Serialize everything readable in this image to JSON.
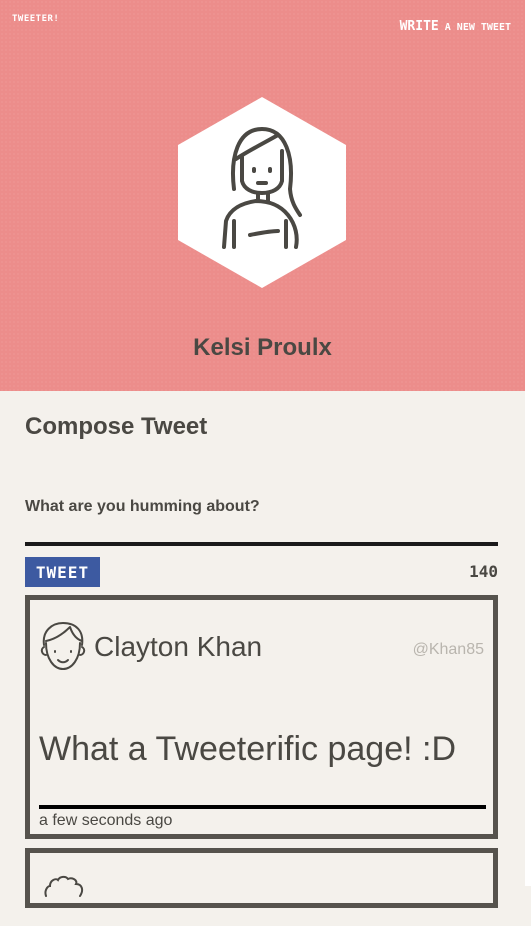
{
  "header": {
    "brand": "TWEETER!",
    "write_link_big": "WRITE",
    "write_link_small": " A NEW TWEET",
    "background_color": "#ec8d8b",
    "profile_name": "Kelsi Proulx",
    "avatar_icon": "woman-portrait-icon"
  },
  "compose": {
    "title": "Compose Tweet",
    "placeholder": "What are you humming about?",
    "button_label": "TWEET",
    "button_color": "#3d5aa1",
    "char_count": "140"
  },
  "tweets": [
    {
      "name": "Clayton Khan",
      "handle": "@Khan85",
      "text": "What a Tweeterific page! :D",
      "time": "a few seconds ago",
      "avatar_icon": "man-face-icon"
    },
    {
      "avatar_icon": "curly-hair-face-icon"
    }
  ]
}
